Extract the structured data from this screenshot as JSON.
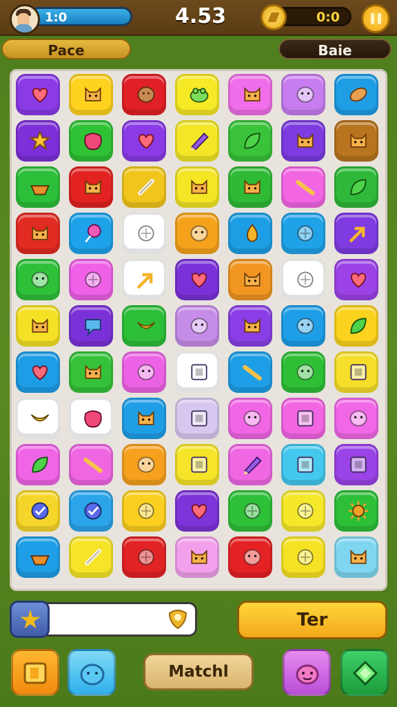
{
  "header": {
    "level_text": "1:0",
    "score": "4.53",
    "coins": "0:0",
    "left_pill": "Pace",
    "right_pill": "Baie"
  },
  "board": {
    "rows": [
      [
        {
          "color": "#8a3be6",
          "icon": "heart"
        },
        {
          "color": "#ffd21f",
          "icon": "cat"
        },
        {
          "color": "#e11f26",
          "icon": "potato"
        },
        {
          "color": "#f6e926",
          "icon": "frog"
        },
        {
          "color": "#f06ee9",
          "icon": "cat"
        },
        {
          "color": "#c77df0",
          "icon": "blob"
        },
        {
          "color": "#1f9ee6",
          "icon": "bread"
        }
      ],
      [
        {
          "color": "#7d2fd8",
          "icon": "star"
        },
        {
          "color": "#2ec234",
          "icon": "sponge"
        },
        {
          "color": "#8a3be6",
          "icon": "heart"
        },
        {
          "color": "#f3e627",
          "icon": "pencil"
        },
        {
          "color": "#39c23a",
          "icon": "leaf"
        },
        {
          "color": "#7d3be0",
          "icon": "cat"
        },
        {
          "color": "#b8741e",
          "icon": "cat"
        }
      ],
      [
        {
          "color": "#2cbf39",
          "icon": "boat"
        },
        {
          "color": "#e22322",
          "icon": "cat"
        },
        {
          "color": "#f0c51c",
          "icon": "bone"
        },
        {
          "color": "#f4e525",
          "icon": "cat"
        },
        {
          "color": "#2fba35",
          "icon": "cat"
        },
        {
          "color": "#f266e4",
          "icon": "stick"
        },
        {
          "color": "#2fb93a",
          "icon": "leaf"
        }
      ],
      [
        {
          "color": "#e22b22",
          "icon": "cat"
        },
        {
          "color": "#1ea2ea",
          "icon": "lolly"
        },
        {
          "color": "#ffffff",
          "icon": "ball"
        },
        {
          "color": "#f4a21c",
          "icon": "blob"
        },
        {
          "color": "#1d9ee4",
          "icon": "drop"
        },
        {
          "color": "#1fa2e8",
          "icon": "ball"
        },
        {
          "color": "#7f3be0",
          "icon": "arrow"
        }
      ],
      [
        {
          "color": "#2fc03a",
          "icon": "blob"
        },
        {
          "color": "#ee60e6",
          "icon": "ball"
        },
        {
          "color": "#ffffff",
          "icon": "arrow"
        },
        {
          "color": "#7a32d8",
          "icon": "heart"
        },
        {
          "color": "#f19622",
          "icon": "cat"
        },
        {
          "color": "#ffffff",
          "icon": "ball"
        },
        {
          "color": "#9b43e6",
          "icon": "heart"
        }
      ],
      [
        {
          "color": "#f4e126",
          "icon": "cat"
        },
        {
          "color": "#7b31d8",
          "icon": "speech"
        },
        {
          "color": "#2dbf38",
          "icon": "banana"
        },
        {
          "color": "#c68de8",
          "icon": "blob"
        },
        {
          "color": "#8a3fe6",
          "icon": "cat"
        },
        {
          "color": "#1e9ee6",
          "icon": "blob"
        },
        {
          "color": "#fbd21e",
          "icon": "leaf"
        }
      ],
      [
        {
          "color": "#1e9ce6",
          "icon": "heart"
        },
        {
          "color": "#35c23a",
          "icon": "cat"
        },
        {
          "color": "#ec62e4",
          "icon": "blob"
        },
        {
          "color": "#ffffff",
          "icon": "box"
        },
        {
          "color": "#1e9ee6",
          "icon": "stick"
        },
        {
          "color": "#2ebf36",
          "icon": "blob"
        },
        {
          "color": "#f6df2a",
          "icon": "box"
        }
      ],
      [
        {
          "color": "#ffffff",
          "icon": "banana"
        },
        {
          "color": "#ffffff",
          "icon": "sponge"
        },
        {
          "color": "#1f9ee6",
          "icon": "cat"
        },
        {
          "color": "#d6c8ee",
          "icon": "box"
        },
        {
          "color": "#f066e4",
          "icon": "blob"
        },
        {
          "color": "#f266e4",
          "icon": "box"
        },
        {
          "color": "#f068e6",
          "icon": "blob"
        }
      ],
      [
        {
          "color": "#f065e6",
          "icon": "leaf"
        },
        {
          "color": "#f066e2",
          "icon": "stick"
        },
        {
          "color": "#f6a01e",
          "icon": "blob"
        },
        {
          "color": "#f5e428",
          "icon": "box"
        },
        {
          "color": "#f067e4",
          "icon": "pencil"
        },
        {
          "color": "#44c8ee",
          "icon": "box"
        },
        {
          "color": "#9a43e6",
          "icon": "box"
        }
      ],
      [
        {
          "color": "#f6d52a",
          "icon": "check"
        },
        {
          "color": "#2ba4ea",
          "icon": "check"
        },
        {
          "color": "#fbcf20",
          "icon": "ball"
        },
        {
          "color": "#7d34d8",
          "icon": "heart"
        },
        {
          "color": "#2fc03a",
          "icon": "ball"
        },
        {
          "color": "#f5e82a",
          "icon": "ball"
        },
        {
          "color": "#2dbf38",
          "icon": "sun"
        }
      ],
      [
        {
          "color": "#1e9ee6",
          "icon": "boat"
        },
        {
          "color": "#f6e428",
          "icon": "bone"
        },
        {
          "color": "#e12325",
          "icon": "ball"
        },
        {
          "color": "#f2a0ec",
          "icon": "cat"
        },
        {
          "color": "#e42224",
          "icon": "blob"
        },
        {
          "color": "#f6e224",
          "icon": "ball"
        },
        {
          "color": "#7fd6f0",
          "icon": "cat"
        }
      ]
    ]
  },
  "footer": {
    "ter_label": "Ter",
    "match_label": "Matchl"
  }
}
